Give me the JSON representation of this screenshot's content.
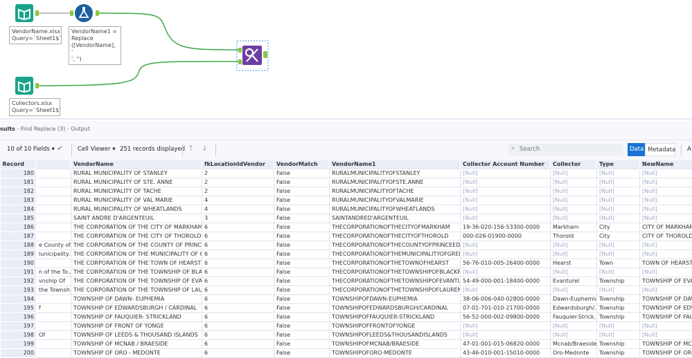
{
  "canvas": {
    "tools": [
      {
        "name": "input-vendorname",
        "icon": "book-icon",
        "annotation": [
          "VendorName.xlsx",
          "Query=`Sheet1$`"
        ]
      },
      {
        "name": "formula",
        "icon": "flask-icon",
        "annotation": [
          "VendorName1 =",
          "Replace",
          "([VendorName], '",
          "', '')"
        ]
      },
      {
        "name": "input-collectors",
        "icon": "book-icon",
        "annotation": [
          "Collectors.xlsx",
          "Query=`Sheet1$`"
        ]
      },
      {
        "name": "find-replace",
        "icon": "find-replace-icon",
        "annotation": []
      }
    ],
    "colors": {
      "input": "#1aa38a",
      "formula": "#1b5f9f",
      "findreplace": "#6b3fa0",
      "connector": "#3aa64a"
    }
  },
  "results": {
    "title_bold": "sults",
    "title_rest": " - Find Replace (3) - Output",
    "fields": "10 of 10 Fields",
    "cell_viewer": "Cell Viewer",
    "records": "251 records displayed",
    "search_placeholder": "Search",
    "data_tab": "Data",
    "metadata_tab": "Metadata",
    "more": "A"
  },
  "table": {
    "columns": [
      "Record",
      "",
      "VendorName",
      "fkLocationIdVendor",
      "VendorMatch",
      "VendorName1",
      "Collector Account Number",
      "Collector",
      "Type",
      "NewName"
    ],
    "rows": [
      [
        "180",
        "",
        "RURAL MUNICIPALITY OF STANLEY",
        "2",
        "False",
        "RURALMUNICIPALITYOFSTANLEY",
        "[Null]",
        "[Null]",
        "[Null]",
        "[Null]"
      ],
      [
        "181",
        "",
        "RURAL MUNICIPALITY OF STE. ANNE",
        "2",
        "False",
        "RURALMUNICIPALITYOFSTE.ANNE",
        "[Null]",
        "[Null]",
        "[Null]",
        "[Null]"
      ],
      [
        "182",
        "",
        "RURAL MUNICIPALITY OF TACHE",
        "2",
        "False",
        "RURALMUNICIPALITYOFTACHE",
        "[Null]",
        "[Null]",
        "[Null]",
        "[Null]"
      ],
      [
        "183",
        "",
        "RURAL MUNICIPALITY OF VAL MARIE",
        "4",
        "False",
        "RURALMUNICIPALITYOFVALMARIE",
        "[Null]",
        "[Null]",
        "[Null]",
        "[Null]"
      ],
      [
        "184",
        "",
        "RURAL MUNICIPALITY OF WHEATLANDS",
        "4",
        "False",
        "RURALMUNICIPALITYOFWHEATLANDS",
        "[Null]",
        "[Null]",
        "[Null]",
        "[Null]"
      ],
      [
        "185",
        "",
        "SAINT ANDRE D'ARGENTEUIL",
        "3",
        "False",
        "SAINTANDRED'ARGENTEUIL",
        "[Null]",
        "[Null]",
        "[Null]",
        "[Null]"
      ],
      [
        "186",
        "",
        "THE CORPORATION OF THE CITY OF MARKHAM",
        "6",
        "False",
        "THECORPORATIONOFTHECITYOFMARKHAM",
        "19-36-020-156-53300-0000",
        "Markham",
        "City",
        "CITY OF MARKHAM"
      ],
      [
        "187",
        "",
        "THE CORPORATION OF THE CITY OF THOROLD",
        "6",
        "False",
        "THECORPORATIONOFTHECITYOFTHOROLD",
        "000-026-01900-0000",
        "Thorold",
        "City",
        "CITY OF THOROLD"
      ],
      [
        "188",
        "e County of",
        "THE CORPORATION OF THE COUNTY OF PRINCE...",
        "6",
        "False",
        "THECORPORATIONOFTHECOUNTYOFPRINCEED...",
        "[Null]",
        "[Null]",
        "[Null]",
        "[Null]"
      ],
      [
        "189",
        "lunicipality...",
        "THE CORPORATION OF THE MUNICIPALITY OF G...",
        "6",
        "False",
        "THECORPORATIONOFTHEMUNICIPALITYOFGREE...",
        "[Null]",
        "[Null]",
        "[Null]",
        "[Null]"
      ],
      [
        "190",
        "",
        "THE CORPORATION OF THE TOWN OF HEARST",
        "6",
        "False",
        "THECORPORATIONOFTHETOWNOFHEARST",
        "56-76-010-005-26400-0000",
        "Hearst",
        "Town",
        "TOWN OF HEARST"
      ],
      [
        "191",
        "n of the To...",
        "THE CORPORATION OF THE TOWNSHIP OF BLAC...",
        "6",
        "False",
        "THECORPORATIONOFTHETOWNSHIPOFBLACKRI...",
        "[Null]",
        "[Null]",
        "[Null]",
        "[Null]"
      ],
      [
        "192",
        "vnship Of",
        "THE CORPORATION OF THE TOWNSHIP OF EVA...",
        "6",
        "False",
        "THECORPORATIONOFTHETOWNSHIPOFEVANTU...",
        "54-49-000-001-18400-0000",
        "Evanturel",
        "Township",
        "TOWNSHIP OF EVAN"
      ],
      [
        "193",
        "the Townsh...",
        "THE CORPORATION OF THE TOWNSHIP OF LAUR...",
        "6",
        "False",
        "THECORPORATIONOFTHETOWNSHIPOFLAUREN...",
        "[Null]",
        "[Null]",
        "[Null]",
        "[Null]"
      ],
      [
        "194",
        "",
        "TOWNSHIP OF DAWN- EUPHEMIA",
        "6",
        "False",
        "TOWNSHIPOFDAWN-EUPHEMIA",
        "38-06-006-040-02800-0000",
        "Dawn-Euphemia",
        "Township",
        "TOWNSHIP OF DAW"
      ],
      [
        "195",
        "f",
        "TOWNSHIP OF EDWARDSBURGH / CARDINAL",
        "6",
        "False",
        "TOWNSHIPOFEDWARDSBURGH/CARDINAL",
        "07-01-701-010-21700-0000",
        "Edwardsburgh/...",
        "Township",
        "TOWNSHIP OF EDW"
      ],
      [
        "196",
        "",
        "TOWNSHIP OF FAUQUIER- STRICKLAND",
        "6",
        "False",
        "TOWNSHIPOFFAUQUIER-STRICKLAND",
        "56-52-000-002-09800-0000",
        "Fauquier-Strick...",
        "Township",
        "TOWNSHIP OF FAUC"
      ],
      [
        "197",
        "",
        "TOWNSHIP OF FRONT OF YONGE",
        "6",
        "False",
        "TOWNSHIPOFFRONTOFYONGE",
        "[Null]",
        "[Null]",
        "[Null]",
        "[Null]"
      ],
      [
        "198",
        "Of",
        "TOWNSHIP OF LEEDS & THOUSAND ISLANDS",
        "6",
        "False",
        "TOWNSHIPOFLEEDS&THOUSANDISLANDS",
        "[Null]",
        "[Null]",
        "[Null]",
        "[Null]"
      ],
      [
        "199",
        "",
        "TOWNSHIP OF MCNAB / BRAESIDE",
        "6",
        "False",
        "TOWNSHIPOFMCNAB/BRAESIDE",
        "47-01-001-015-06820-0000",
        "Mcnab/Braeside",
        "Township",
        "TOWNSHIP OF MCN"
      ],
      [
        "200",
        "",
        "TOWNSHIP OF ORO - MEDONTE",
        "6",
        "False",
        "TOWNSHIPOFORO-MEDONTE",
        "43-46-010-001-15010-0000",
        "Oro-Medonte",
        "Township",
        "TOWNSHIP OF ORO"
      ]
    ]
  }
}
